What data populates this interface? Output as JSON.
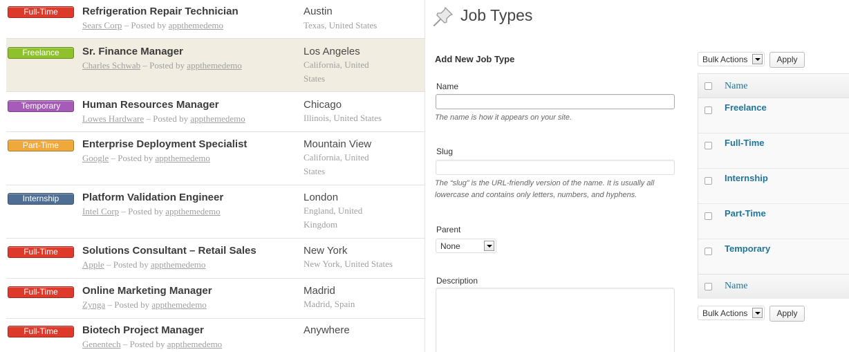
{
  "jobs": [
    {
      "type": "Full-Time",
      "type_color": "#dd3a2c",
      "title": "Refrigeration Repair Technician",
      "company": "Sears Corp",
      "posted_sep": " – Posted by ",
      "author": "appthemedemo",
      "city": "Austin",
      "region": "Texas, United States"
    },
    {
      "type": "Freelance",
      "type_color": "#8ec12c",
      "title": "Sr. Finance Manager",
      "company": "Charles Schwab",
      "posted_sep": " – Posted by ",
      "author": "appthemedemo",
      "city": "Los Angeles",
      "region": "California, United States"
    },
    {
      "type": "Temporary",
      "type_color": "#a75bb9",
      "title": "Human Resources Manager",
      "company": "Lowes Hardware",
      "posted_sep": " – Posted by ",
      "author": "appthemedemo",
      "city": "Chicago",
      "region": "Illinois, United States"
    },
    {
      "type": "Part-Time",
      "type_color": "#eea83b",
      "title": "Enterprise Deployment Specialist",
      "company": "Google",
      "posted_sep": " – Posted by ",
      "author": "appthemedemo",
      "city": "Mountain View",
      "region": "California, United States"
    },
    {
      "type": "Internship",
      "type_color": "#4e6e93",
      "title": "Platform Validation Engineer",
      "company": "Intel Corp",
      "posted_sep": " – Posted by ",
      "author": "appthemedemo",
      "city": "London",
      "region": "England, United Kingdom"
    },
    {
      "type": "Full-Time",
      "type_color": "#dd3a2c",
      "title": "Solutions Consultant – Retail Sales",
      "company": "Apple",
      "posted_sep": " – Posted by ",
      "author": "appthemedemo",
      "city": "New York",
      "region": "New York, United States"
    },
    {
      "type": "Full-Time",
      "type_color": "#dd3a2c",
      "title": "Online Marketing Manager",
      "company": "Zynga",
      "posted_sep": " – Posted by ",
      "author": "appthemedemo",
      "city": "Madrid",
      "region": "Madrid, Spain"
    },
    {
      "type": "Full-Time",
      "type_color": "#dd3a2c",
      "title": "Biotech Project Manager",
      "company": "Genentech",
      "posted_sep": " – Posted by ",
      "author": "appthemedemo",
      "city": "Anywhere",
      "region": ""
    }
  ],
  "admin": {
    "page_title": "Job Types",
    "title_icon": "pushpin-icon",
    "form": {
      "heading": "Add New Job Type",
      "name_label": "Name",
      "name_value": "",
      "name_help": "The name is how it appears on your site.",
      "slug_label": "Slug",
      "slug_value": "",
      "slug_help": "The “slug” is the URL-friendly version of the name. It is usually all lowercase and contains only letters, numbers, and hyphens.",
      "parent_label": "Parent",
      "parent_value": "None",
      "description_label": "Description",
      "description_value": ""
    },
    "bulk_actions": "Bulk Actions",
    "apply": "Apply",
    "table": {
      "header": "Name",
      "footer": "Name",
      "rows": [
        "Freelance",
        "Full-Time",
        "Internship",
        "Part-Time",
        "Temporary"
      ]
    }
  }
}
